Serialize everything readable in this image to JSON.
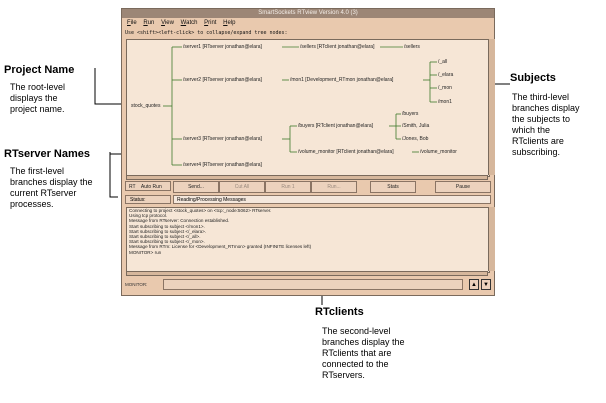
{
  "window": {
    "title": "SmartSockets RTview Version 4.0 (3)",
    "menu": [
      "File",
      "Run",
      "View",
      "Watch",
      "Print",
      "Help"
    ],
    "hint": "Use <shift><left-click> to collapse/expand tree nodes:"
  },
  "tree": {
    "root": "stock_quotes",
    "servers": [
      "/server1 [RTserver jonathan@elara]",
      "/server2 [RTserver jonathan@elara]",
      "/server3 [RTserver jonathan@elara]",
      "/server4 [RTserver jonathan@elara]"
    ],
    "clients": [
      "/sellers [RTclient jonathan@elara]",
      "/mon1 [Development_RTmon jonathan@elara]",
      "/buyers [RTclient jonathan@elara]",
      "/volume_monitor [RTclient jonathan@elara]"
    ],
    "subjects": {
      "sellers": "/sellers",
      "mon1": [
        "/_all",
        "/_elara",
        "/_mon",
        "/mon1"
      ],
      "buyers": [
        "/buyers",
        "/Smith, Julia",
        "/Jones, Bob"
      ],
      "volume_monitor": "/volume_monitor"
    }
  },
  "buttons": {
    "rt_toggle": "RT",
    "auto_run": "Auto Run",
    "send": "Send...",
    "cut_all": "Cut All",
    "run1": "Run 1",
    "run": "Run...",
    "stats": "Stats",
    "pause": "Pause"
  },
  "status": {
    "label": "Status:",
    "text": "Reading/Processing Messages"
  },
  "log": [
    "Connecting to project <stock_quotes> on <tcp:_node:5062> RTserver.",
    "Using tcp protocol.",
    "Message from RTserver: Connection established.",
    "Start subscribing to subject </mon1>.",
    "Start subscribing to subject </_elara>.",
    "Start subscribing to subject </_all>.",
    "Start subscribing to subject </_mon>.",
    "Message from RTm: License for <Development_RTmon> granted (INFINITE licenses left)",
    "MONITOR> run"
  ],
  "command": {
    "label": "MONITOR:",
    "value": ""
  },
  "icons": {
    "up": "up-arrow-icon",
    "down": "down-arrow-icon"
  },
  "callouts": {
    "project": {
      "title": "Project Name",
      "body": [
        "The root-level",
        "displays the",
        "project name."
      ]
    },
    "rtserver": {
      "title": "RTserver Names",
      "body": [
        "The first-level",
        "branches display the",
        "current RTserver",
        "processes."
      ]
    },
    "subjects": {
      "title": "Subjects",
      "body": [
        "The third-level",
        "branches display",
        "the subjects to",
        "which the",
        "RTclients are",
        "subscribing."
      ]
    },
    "rtclients": {
      "title": "RTclients",
      "body": [
        "The second-level",
        "branches display the",
        "RTclients that are",
        "connected to the",
        "RTservers."
      ]
    }
  },
  "colors": {
    "window_bg": "#e9c9ae",
    "panel_bg": "#f6e6d6",
    "tree_line": "#3f7a2a",
    "titlebar": "#9c8676"
  }
}
